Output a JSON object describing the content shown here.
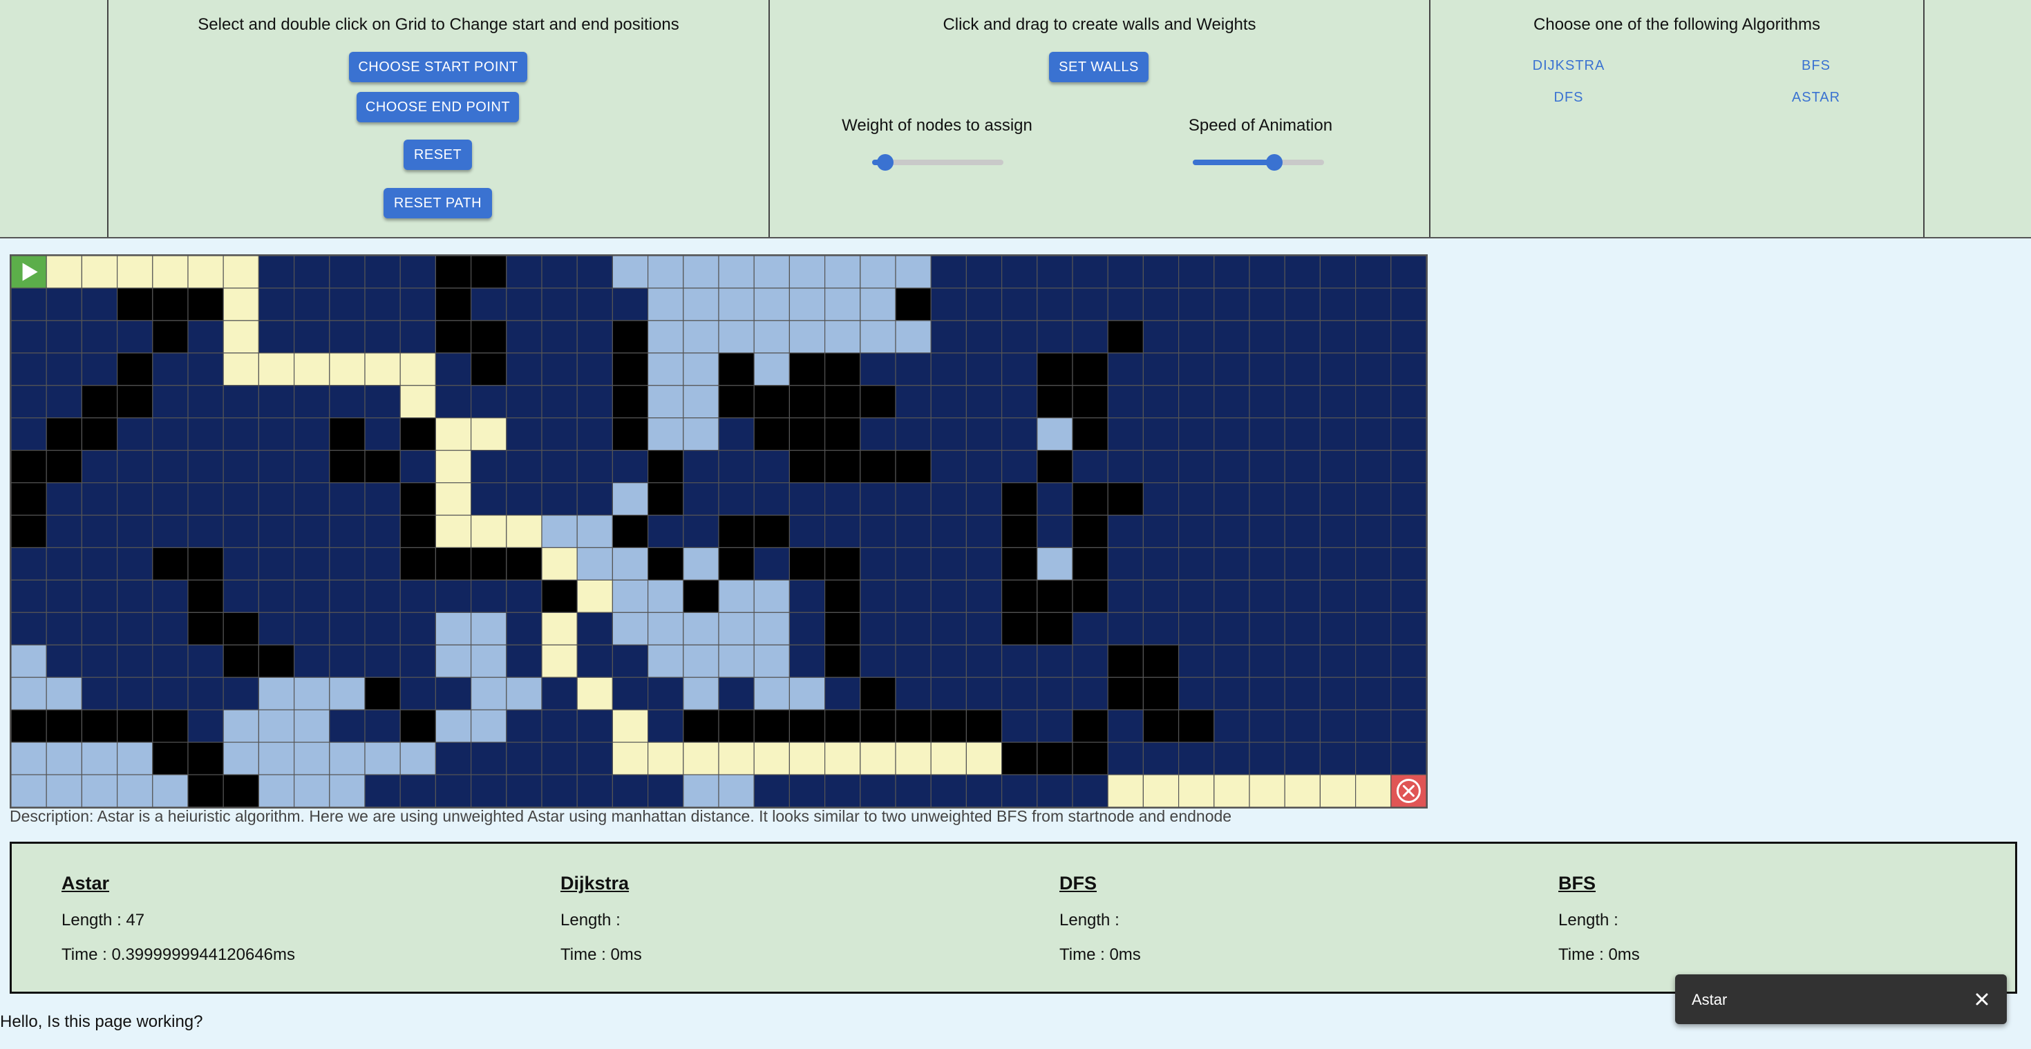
{
  "controls": {
    "positions": {
      "title": "Select and double click on Grid to Change start and end positions",
      "choose_start": "CHOOSE START POINT",
      "choose_end": "CHOOSE END POINT",
      "reset": "RESET",
      "reset_path": "RESET PATH"
    },
    "walls": {
      "title": "Click and drag to create walls and Weights",
      "set_walls": "SET WALLS",
      "weight_label": "Weight of nodes to assign",
      "speed_label": "Speed of Animation",
      "weight_value": 0.1,
      "speed_value": 0.62
    },
    "algorithms": {
      "title": "Choose one of the following Algorithms",
      "items": [
        "DIJKSTRA",
        "BFS",
        "DFS",
        "ASTAR"
      ]
    }
  },
  "grid": {
    "legend": {
      "#": "wall",
      "v": "visited",
      "p": "path",
      ".": "empty",
      "S": "start",
      "E": "end"
    },
    "colors": {
      "empty": "#11255f",
      "wall": "#000000",
      "visited": "#a0bde0",
      "path": "#f7f4c2",
      "start": "#5cae4a",
      "end": "#e05555",
      "line": "#555555"
    },
    "rows": [
      "Spppppp.....##...vvvvvvvvv.........",
      "...###p.....#.....vvvvvvv#.........",
      "....#.p.....##...#vvvvvvvv.....#...",
      "...#..pppppp.#...#vv#v##.....##....",
      "..##.......p.....#vv#####....##....",
      ".##......#.#pp...#vv.###.....v#....",
      "##.......##.p.....#...####...#.....",
      "#..........#p....v#.........#.##...",
      "#..........#pppvv#..##......#.#....",
      "....##.....####pvv#v#.##....#v#....",
      ".....#.........#pvv#vv.#....###....",
      ".....##.....vv.p.vvvvv.#....##.....",
      "v.....##....vv.p..vvvv.#.......##..",
      "vv.....vvv#..vv.p..v.vv.#......##...",
      "#####.vvv..#vv...p.#########..#.##....",
      "vvvv##vvvvvv.....ppppppppppp###.....",
      "vvvvv##vvv.........vv..........ppppppppE"
    ]
  },
  "description": "Description: Astar is a heiuristic algorithm. Here we are using unweighted Astar using manhattan distance. It looks similar to two unweighted BFS from startnode and endnode",
  "stats": [
    {
      "name": "Astar",
      "length": "Length : 47",
      "time": "Time : 0.3999999944120646ms"
    },
    {
      "name": "Dijkstra",
      "length": "Length :",
      "time": "Time : 0ms"
    },
    {
      "name": "DFS",
      "length": "Length :",
      "time": "Time : 0ms"
    },
    {
      "name": "BFS",
      "length": "Length :",
      "time": "Time : 0ms"
    }
  ],
  "footer": {
    "message": "Hello, Is this page working?"
  },
  "toast": {
    "message": "Astar"
  },
  "icons": {
    "start": "play-icon",
    "end": "close-circle-icon",
    "toast_close": "close-icon"
  }
}
